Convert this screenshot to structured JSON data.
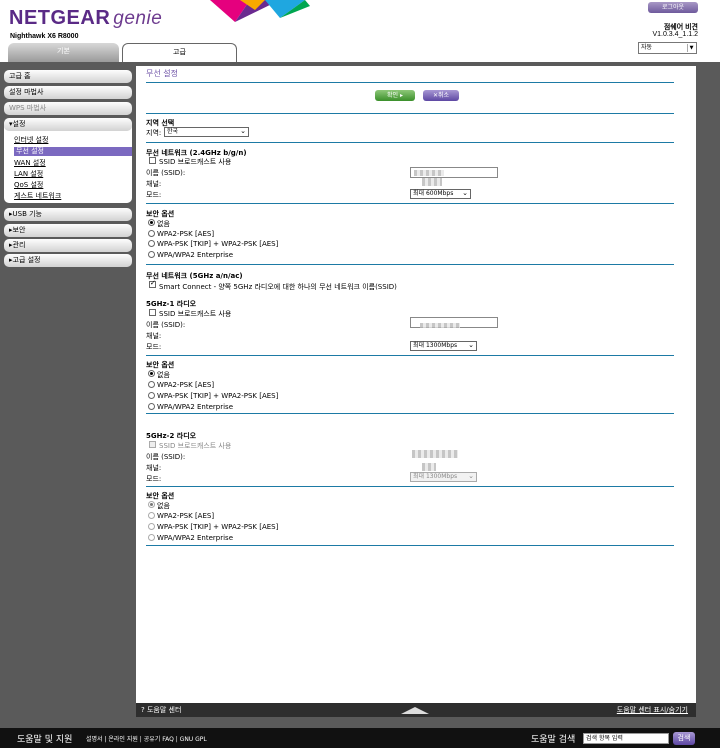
{
  "header": {
    "brand": "NETGEAR",
    "brand_product": "genie",
    "model": "Nighthawk X6 R8000",
    "logout_label": "로그아웃",
    "router_name": "점쉐어 비견",
    "firmware": "V1.0.3.4_1.1.2",
    "language_selected": "자동"
  },
  "tabs": {
    "basic": "기본",
    "advanced": "고급"
  },
  "sidebar": {
    "home": "고급 홈",
    "wizard": "설정 마법사",
    "wps": "WPS 마법사",
    "setup": "▾설정",
    "setup_items": [
      "인터넷 설정",
      "무선 설정",
      "WAN 설정",
      "LAN 설정",
      "QoS 설정",
      "게스트 네트워크"
    ],
    "usb": "▸USB 기능",
    "security": "▸보안",
    "admin": "▸관리",
    "advanced_setup": "▸고급 설정"
  },
  "page": {
    "title": "무선 설정",
    "apply_label": "확인 ▸",
    "cancel_label": "✕취소"
  },
  "region": {
    "heading": "지역 선택",
    "label": "지역:",
    "value": "한국"
  },
  "net24": {
    "heading": "무선 네트워크 (2.4GHz b/g/n)",
    "ssid_broadcast_label": "SSID 브로드캐스트 사용",
    "ssid_label": "이름 (SSID):",
    "channel_label": "채널:",
    "mode_label": "모드:",
    "mode_value": "최대 600Mbps"
  },
  "sec24": {
    "heading": "보안 옵션",
    "options": [
      "없음",
      "WPA2-PSK [AES]",
      "WPA-PSK [TKIP] + WPA2-PSK [AES]",
      "WPA/WPA2 Enterprise"
    ]
  },
  "net5": {
    "heading": "무선 네트워크 (5GHz a/n/ac)",
    "smart_connect_label": "Smart Connect - 양쪽 5GHz 라디오에 대한 하나의 무선 네트워크 이름(SSID)"
  },
  "radio1": {
    "heading": "5GHz-1 라디오",
    "ssid_broadcast_label": "SSID 브로드캐스트 사용",
    "ssid_label": "이름 (SSID):",
    "channel_label": "채널:",
    "mode_label": "모드:",
    "mode_value": "최대 1300Mbps"
  },
  "sec1": {
    "heading": "보안 옵션",
    "options": [
      "없음",
      "WPA2-PSK [AES]",
      "WPA-PSK [TKIP] + WPA2-PSK [AES]",
      "WPA/WPA2 Enterprise"
    ]
  },
  "radio2": {
    "heading": "5GHz-2 라디오",
    "ssid_broadcast_label": "SSID 브로드캐스트 사용",
    "ssid_label": "이름 (SSID):",
    "channel_label": "채널:",
    "mode_label": "모드:",
    "mode_value": "최대 1300Mbps"
  },
  "sec2": {
    "heading": "보안 옵션",
    "options": [
      "없음",
      "WPA2-PSK [AES]",
      "WPA-PSK [TKIP] + WPA2-PSK [AES]",
      "WPA/WPA2 Enterprise"
    ]
  },
  "help_bar": {
    "help_center": "도움말 센터",
    "toggle": "도움말 센터 표시/숨기기"
  },
  "footer": {
    "support_title": "도움말 및 지원",
    "support_links": "설명서 | 온라인 지원 | 공유기 FAQ | GNU GPL",
    "search_title": "도움말 검색",
    "search_placeholder": "검색 항목 입력",
    "search_button": "검색"
  },
  "colors": {
    "brand_purple": "#5a2a86",
    "accent_line": "#1d7aa5",
    "active_nav": "#7b69c0",
    "apply_green": "#3a8f2a"
  }
}
